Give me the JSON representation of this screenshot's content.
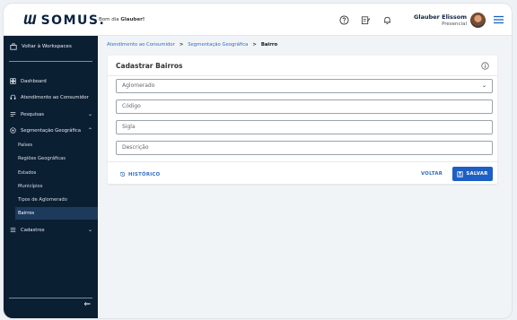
{
  "header": {
    "logo_mark": "Ɯ",
    "logo_text": "SOMUS.",
    "greeting_prefix": "Bom dia ",
    "greeting_name": "Glauber!",
    "user_name": "Glauber Elissom",
    "user_status": "Presencial"
  },
  "sidebar": {
    "workspace_label": "Voltar à Workspaces",
    "items": [
      {
        "label": "Dashboard"
      },
      {
        "label": "Atendimento ao Consumidor"
      },
      {
        "label": "Pesquisas"
      },
      {
        "label": "Segmentação Geográfica"
      },
      {
        "label": "Cadastros"
      }
    ],
    "sub_items": [
      {
        "label": "Países"
      },
      {
        "label": "Regiões Geográficas"
      },
      {
        "label": "Estados"
      },
      {
        "label": "Municípios"
      },
      {
        "label": "Tipos de Aglomerado"
      },
      {
        "label": "Bairros"
      }
    ],
    "collapse_glyph": "⇐"
  },
  "breadcrumb": {
    "items": [
      "Atendimento ao Consumidor",
      "Segmentação Geográfica",
      "Bairro"
    ],
    "separator": ">"
  },
  "form": {
    "title": "Cadastrar Bairros",
    "fields": [
      {
        "placeholder": "Aglomerado",
        "type": "select"
      },
      {
        "placeholder": "Código"
      },
      {
        "placeholder": "Sigla"
      },
      {
        "placeholder": "Descrição"
      }
    ],
    "history_label": "HISTÓRICO",
    "back_label": "VOLTAR",
    "save_label": "SALVAR"
  },
  "colors": {
    "sidebar_bg": "#0b1f33",
    "accent": "#1c5fc5",
    "link": "#2f6ac1"
  }
}
